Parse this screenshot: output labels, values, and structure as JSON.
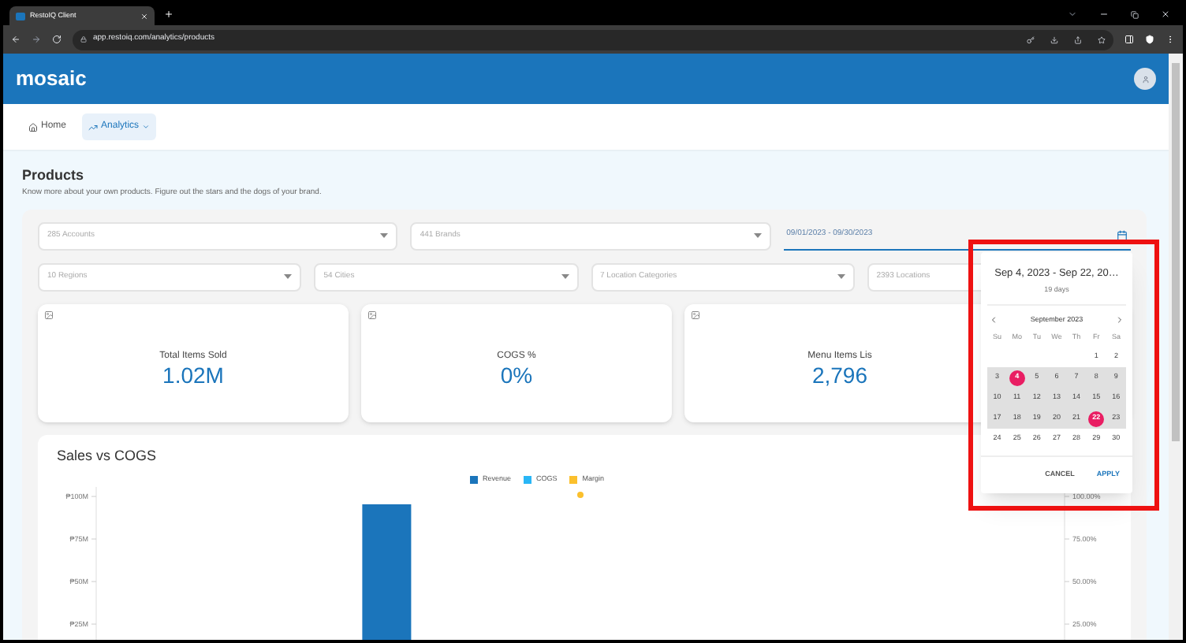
{
  "browser": {
    "tab_title": "RestoIQ Client",
    "url": "app.restoiq.com/analytics/products"
  },
  "header": {
    "logo": "mosaic"
  },
  "nav": [
    {
      "label": "Home",
      "selected": false,
      "dropdown": false
    },
    {
      "label": "Analytics",
      "selected": true,
      "dropdown": true
    }
  ],
  "page": {
    "title": "Products",
    "subtitle": "Know more about your own products. Figure out the stars and the dogs of your brand."
  },
  "filters": [
    [
      {
        "kind": "select",
        "placeholder": "285 Accounts"
      },
      {
        "kind": "select",
        "placeholder": "441 Brands"
      },
      {
        "kind": "date",
        "value": "09/01/2023 - 09/30/2023"
      }
    ],
    [
      {
        "kind": "select",
        "placeholder": "10 Regions"
      },
      {
        "kind": "select",
        "placeholder": "54 Cities"
      },
      {
        "kind": "select",
        "placeholder": "7 Location Categories"
      },
      {
        "kind": "select",
        "placeholder": "2393 Locations"
      }
    ]
  ],
  "kpis": [
    {
      "label": "Total Items Sold",
      "value": "1.02M"
    },
    {
      "label": "COGS %",
      "value": "0%"
    },
    {
      "label": "Menu Items Lis",
      "value": "2,796"
    }
  ],
  "date_picker": {
    "range": "Sep 4, 2023 - Sep 22, 20…",
    "duration": "19 days",
    "month": "September 2023",
    "weekdays": [
      "Su",
      "Mo",
      "Tu",
      "We",
      "Th",
      "Fr",
      "Sa"
    ],
    "weeks": [
      [
        {
          "day": "1",
          "selected": false,
          "in_range": false
        },
        {
          "day": "2",
          "selected": false,
          "in_range": false
        }
      ],
      [
        {
          "day": "3",
          "selected": false,
          "in_range": true
        },
        {
          "day": "4",
          "selected": true,
          "in_range": true
        },
        {
          "day": "5",
          "selected": false,
          "in_range": true
        },
        {
          "day": "6",
          "selected": false,
          "in_range": true
        },
        {
          "day": "7",
          "selected": false,
          "in_range": true
        },
        {
          "day": "8",
          "selected": false,
          "in_range": true
        },
        {
          "day": "9",
          "selected": false,
          "in_range": true
        }
      ],
      [
        {
          "day": "10",
          "selected": false,
          "in_range": true
        },
        {
          "day": "11",
          "selected": false,
          "in_range": true
        },
        {
          "day": "12",
          "selected": false,
          "in_range": true
        },
        {
          "day": "13",
          "selected": false,
          "in_range": true
        },
        {
          "day": "14",
          "selected": false,
          "in_range": true
        },
        {
          "day": "15",
          "selected": false,
          "in_range": true
        },
        {
          "day": "16",
          "selected": false,
          "in_range": true
        }
      ],
      [
        {
          "day": "17",
          "selected": false,
          "in_range": true
        },
        {
          "day": "18",
          "selected": false,
          "in_range": true
        },
        {
          "day": "19",
          "selected": false,
          "in_range": true
        },
        {
          "day": "20",
          "selected": false,
          "in_range": true
        },
        {
          "day": "21",
          "selected": false,
          "in_range": true
        },
        {
          "day": "22",
          "selected": true,
          "in_range": true
        },
        {
          "day": "23",
          "selected": false,
          "in_range": true
        }
      ],
      [
        {
          "day": "24",
          "selected": false,
          "in_range": false
        },
        {
          "day": "25",
          "selected": false,
          "in_range": false
        },
        {
          "day": "26",
          "selected": false,
          "in_range": false
        },
        {
          "day": "27",
          "selected": false,
          "in_range": false
        },
        {
          "day": "28",
          "selected": false,
          "in_range": false
        },
        {
          "day": "29",
          "selected": false,
          "in_range": false
        },
        {
          "day": "30",
          "selected": false,
          "in_range": false
        }
      ]
    ],
    "actions": [
      {
        "label": "CANCEL",
        "kind": "secondary"
      },
      {
        "label": "APPLY",
        "kind": "primary"
      }
    ]
  },
  "chart": {
    "title": "Sales vs COGS",
    "legend": [
      {
        "name": "Revenue",
        "color": "#1b75bb"
      },
      {
        "name": "COGS",
        "color": "#29b6f6"
      },
      {
        "name": "Margin",
        "color": "#fbc02d"
      }
    ],
    "left_axis_labels": [
      "₱100M",
      "₱75M",
      "₱50M",
      "₱25M"
    ],
    "right_axis_labels": [
      "100.00%",
      "75.00%",
      "50.00%",
      "25.00%"
    ]
  }
}
